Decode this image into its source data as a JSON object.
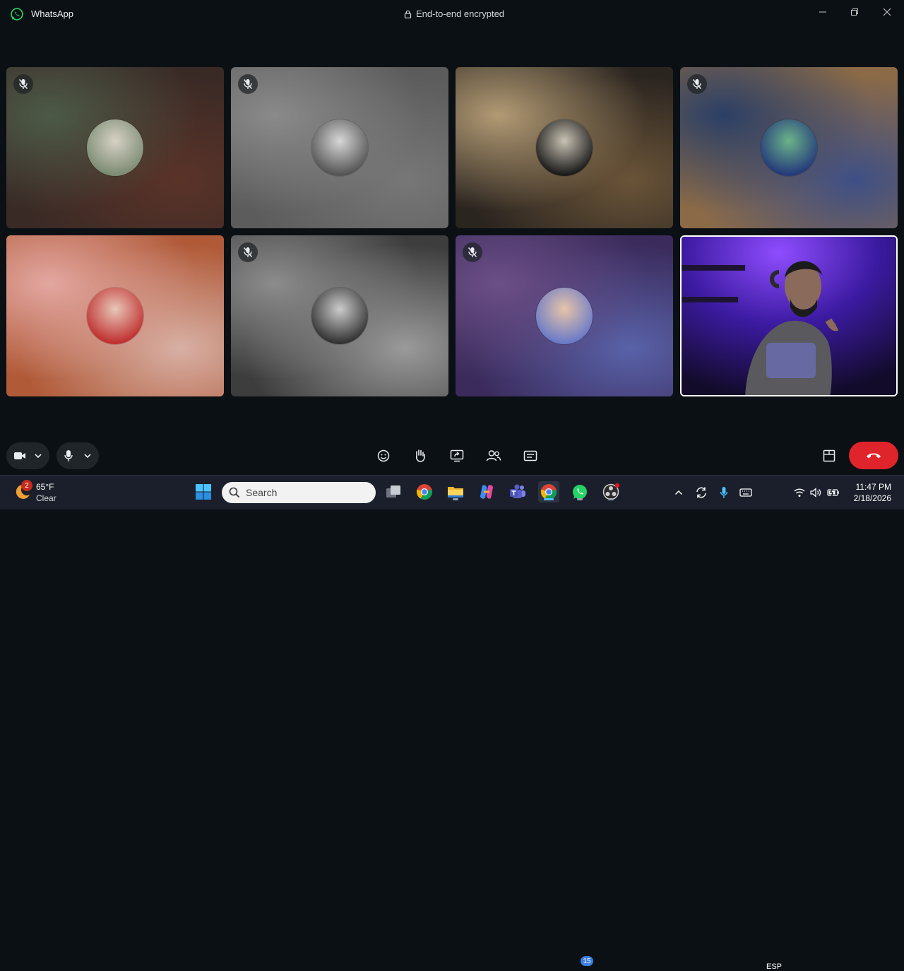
{
  "window": {
    "app_title": "WhatsApp",
    "encryption_label": "End-to-end encrypted",
    "icons": [
      "whatsapp-logo",
      "lock-icon",
      "minimize-icon",
      "maximize-icon",
      "close-icon"
    ]
  },
  "call": {
    "participants": [
      {
        "muted": true,
        "bg": [
          "#4d5a47",
          "#3a2a26",
          "#5a3328"
        ],
        "avatar": [
          "#d6d1c5",
          "#7d8c74"
        ]
      },
      {
        "muted": true,
        "bg": [
          "#8a8a8a",
          "#5c5c5c",
          "#777777"
        ],
        "avatar": [
          "#d7d7d7",
          "#555555"
        ]
      },
      {
        "muted": false,
        "bg": [
          "#b29a74",
          "#2b2520",
          "#6a5438"
        ],
        "avatar": [
          "#c9c2b3",
          "#1b1b1b"
        ]
      },
      {
        "muted": true,
        "bg": [
          "#2b3f66",
          "#8a6a47",
          "#3e4f86"
        ],
        "avatar": [
          "#6cb48a",
          "#243a7a"
        ]
      },
      {
        "muted": false,
        "bg": [
          "#e3a7a1",
          "#b05a38",
          "#d8b0a5"
        ],
        "avatar": [
          "#e7c7b8",
          "#c03030"
        ]
      },
      {
        "muted": true,
        "bg": [
          "#8c8c8c",
          "#3d3d3d",
          "#9a9a9a"
        ],
        "avatar": [
          "#cccccc",
          "#333333"
        ]
      },
      {
        "muted": true,
        "bg": [
          "#6b4f86",
          "#3b2b5c",
          "#5962a8"
        ],
        "avatar": [
          "#e6c4a8",
          "#6a7ac8"
        ]
      },
      {
        "muted": false,
        "self": true,
        "bg": [
          "#2a1a66",
          "#6d2bd6",
          "#1a1230"
        ],
        "avatar": [
          "#6e6e6e",
          "#1b1b1b"
        ]
      }
    ]
  },
  "controls": {
    "left": [
      "video-camera-icon",
      "chevron-down-icon",
      "microphone-icon",
      "chevron-down-icon"
    ],
    "center": [
      "emoji-icon",
      "raise-hand-icon",
      "share-screen-icon",
      "participants-icon",
      "captions-icon"
    ],
    "right": [
      "layout-icon",
      "end-call-icon"
    ],
    "end_call_color": "#e0242b"
  },
  "taskbar": {
    "weather_badge": "2",
    "temperature": "65°F",
    "condition": "Clear",
    "search_placeholder": "Search",
    "whatsapp_badge": "15",
    "language": "ESP",
    "time": "11:47 PM",
    "date": "2/18/2026"
  }
}
